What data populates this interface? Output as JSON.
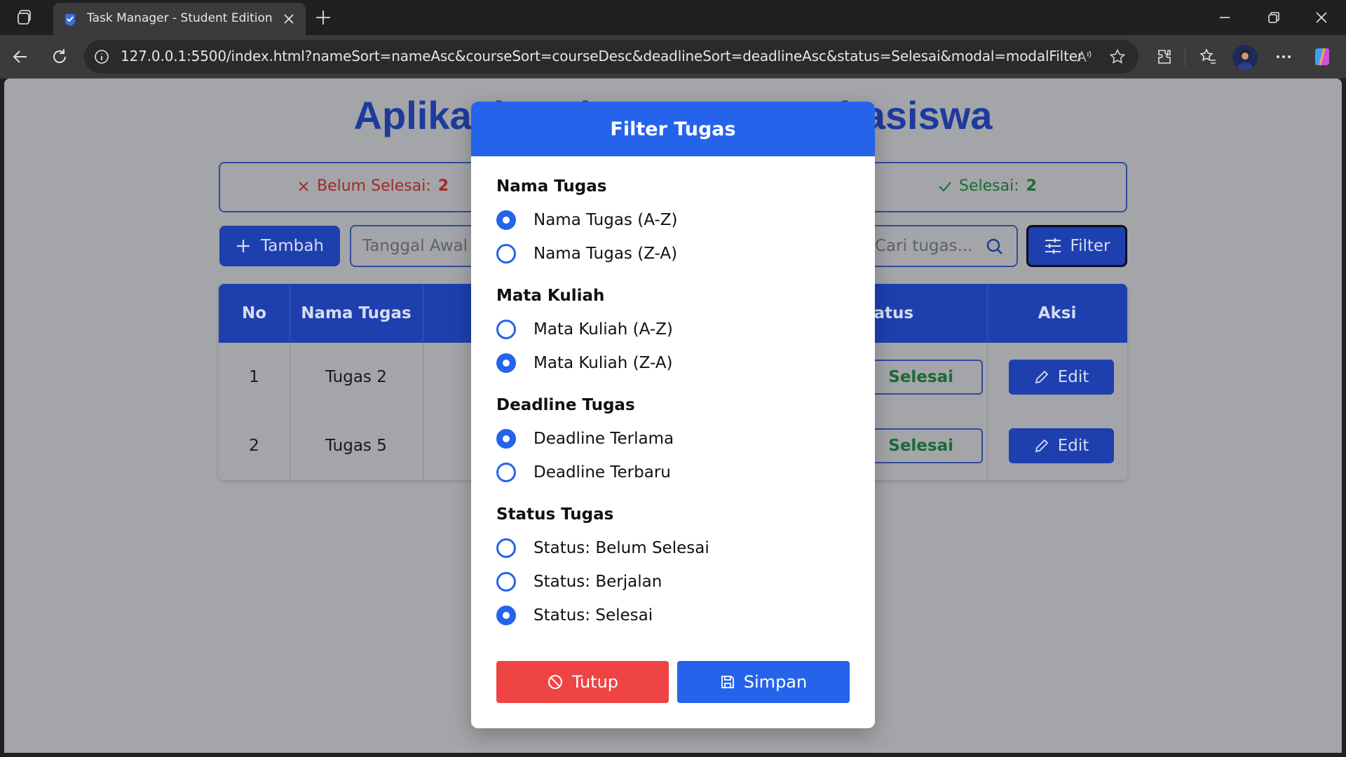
{
  "browser": {
    "tab_title": "Task Manager - Student Edition",
    "url": "127.0.0.1:5500/index.html?nameSort=nameAsc&courseSort=courseDesc&deadlineSort=deadlineAsc&status=Selesai&modal=modalFilter"
  },
  "page": {
    "title": "Aplikasi Task Manager Mahasiswa",
    "stats": {
      "pending_label": "Belum Selesai:",
      "pending_count": "2",
      "done_label": "Selesai:",
      "done_count": "2"
    },
    "toolbar": {
      "add_label": "Tambah",
      "start_date_placeholder": "Tanggal Awal",
      "search_placeholder": "Cari tugas...",
      "filter_label": "Filter"
    },
    "table": {
      "headers": [
        "No",
        "Nama Tugas",
        "Status",
        "Aksi"
      ],
      "rows": [
        {
          "no": "1",
          "name": "Tugas 2",
          "status": "Selesai",
          "action": "Edit"
        },
        {
          "no": "2",
          "name": "Tugas 5",
          "status": "Selesai",
          "action": "Edit"
        }
      ]
    }
  },
  "modal": {
    "title": "Filter Tugas",
    "groups": [
      {
        "title": "Nama Tugas",
        "options": [
          {
            "label": "Nama Tugas (A-Z)",
            "checked": true
          },
          {
            "label": "Nama Tugas (Z-A)",
            "checked": false
          }
        ]
      },
      {
        "title": "Mata Kuliah",
        "options": [
          {
            "label": "Mata Kuliah (A-Z)",
            "checked": false
          },
          {
            "label": "Mata Kuliah (Z-A)",
            "checked": true
          }
        ]
      },
      {
        "title": "Deadline Tugas",
        "options": [
          {
            "label": "Deadline Terlama",
            "checked": true
          },
          {
            "label": "Deadline Terbaru",
            "checked": false
          }
        ]
      },
      {
        "title": "Status Tugas",
        "options": [
          {
            "label": "Status: Belum Selesai",
            "checked": false
          },
          {
            "label": "Status: Berjalan",
            "checked": false
          },
          {
            "label": "Status: Selesai",
            "checked": true
          }
        ]
      }
    ],
    "close_label": "Tutup",
    "save_label": "Simpan"
  },
  "colors": {
    "primary": "#1e40af",
    "modal_blue": "#2563eb",
    "danger": "#ef4444",
    "success_text": "#1c6a37",
    "danger_text": "#a12a2a"
  }
}
